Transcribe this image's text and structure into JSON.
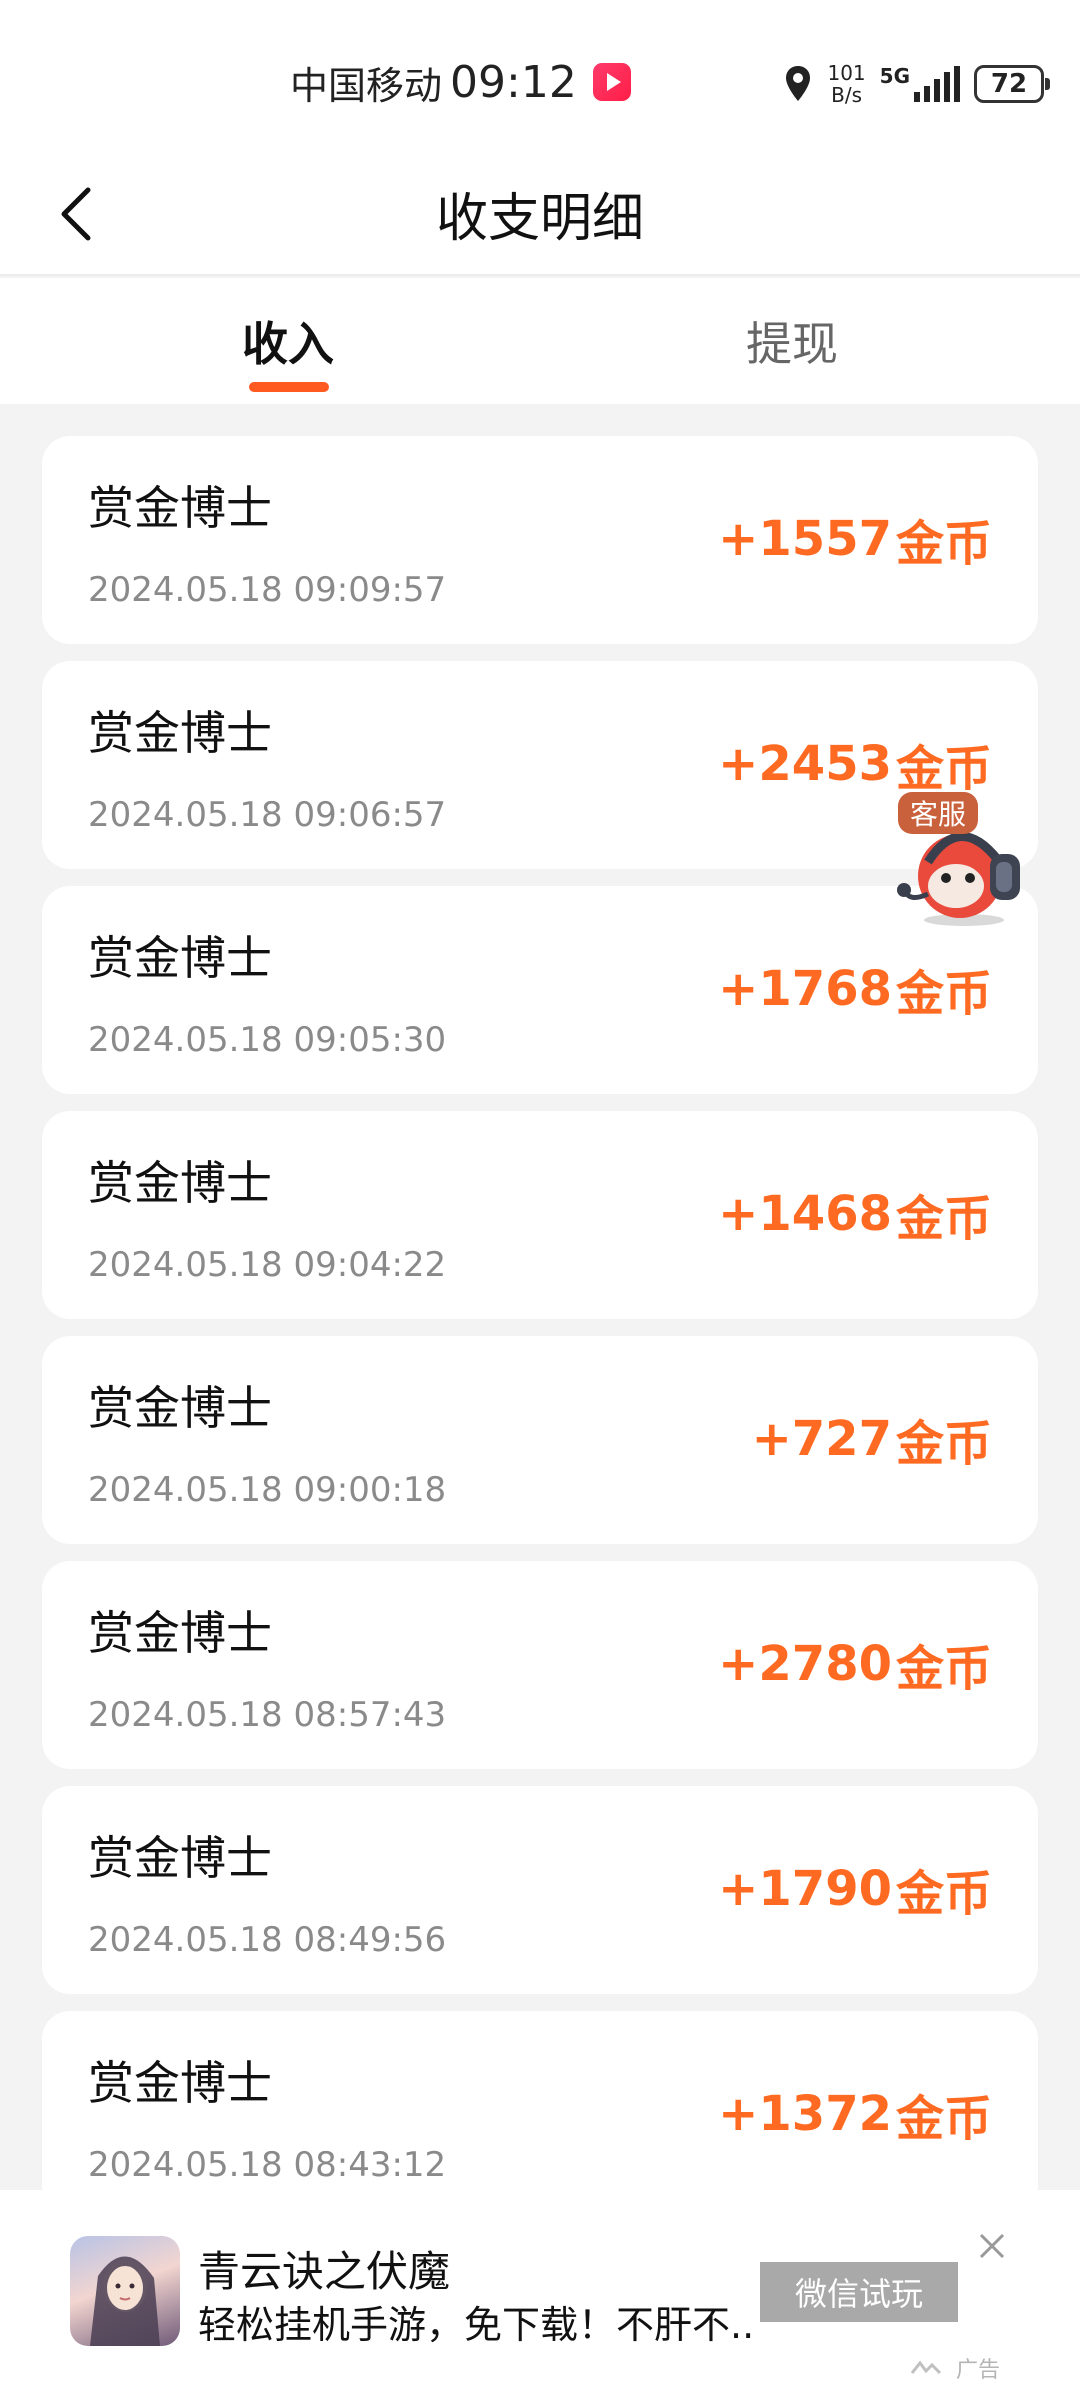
{
  "status_bar": {
    "carrier": "中国移动",
    "time": "09:12",
    "net_speed_value": "101",
    "net_speed_unit": "B/s",
    "network": "5G",
    "battery": "72"
  },
  "header": {
    "title": "收支明细",
    "back_icon": "chevron-left-icon"
  },
  "tabs": [
    {
      "label": "收入",
      "active": true
    },
    {
      "label": "提现",
      "active": false
    }
  ],
  "transactions": [
    {
      "name": "赏金博士",
      "time": "2024.05.18 09:09:57",
      "amount": "+1557",
      "unit": "金币"
    },
    {
      "name": "赏金博士",
      "time": "2024.05.18 09:06:57",
      "amount": "+2453",
      "unit": "金币"
    },
    {
      "name": "赏金博士",
      "time": "2024.05.18 09:05:30",
      "amount": "+1768",
      "unit": "金币"
    },
    {
      "name": "赏金博士",
      "time": "2024.05.18 09:04:22",
      "amount": "+1468",
      "unit": "金币"
    },
    {
      "name": "赏金博士",
      "time": "2024.05.18 09:00:18",
      "amount": "+727",
      "unit": "金币"
    },
    {
      "name": "赏金博士",
      "time": "2024.05.18 08:57:43",
      "amount": "+2780",
      "unit": "金币"
    },
    {
      "name": "赏金博士",
      "time": "2024.05.18 08:49:56",
      "amount": "+1790",
      "unit": "金币"
    },
    {
      "name": "赏金博士",
      "time": "2024.05.18 08:43:12",
      "amount": "+1372",
      "unit": "金币"
    }
  ],
  "customer_service": {
    "label": "客服"
  },
  "ad": {
    "title": "青云诀之伏魔",
    "description": "轻松挂机手游，免下载！不肝不...",
    "button": "微信试玩",
    "tag": "广告"
  },
  "colors": {
    "accent": "#ff5a1f",
    "amount": "#ff6a22",
    "background": "#f3f3f3"
  }
}
